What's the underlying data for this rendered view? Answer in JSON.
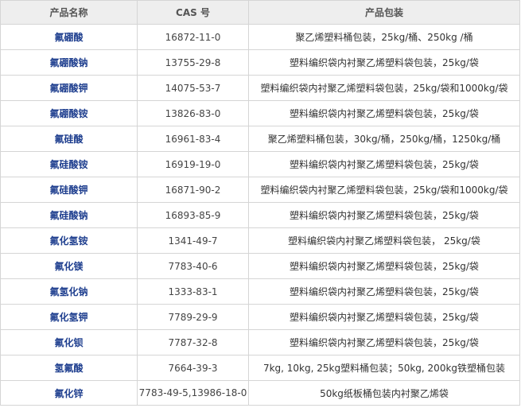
{
  "headers": {
    "name": "产品名称",
    "cas": "CAS 号",
    "packaging": "产品包装"
  },
  "colors": {
    "header_bg": "#eeeeee",
    "name_text": "#1f3f8f",
    "border": "#d5d5d5"
  },
  "rows": [
    {
      "name": "氟硼酸",
      "cas": "16872-11-0",
      "packaging": "聚乙烯塑料桶包装，25kg/桶、250kg /桶"
    },
    {
      "name": "氟硼酸钠",
      "cas": "13755-29-8",
      "packaging": "塑料编织袋内衬聚乙烯塑料袋包装，25kg/袋"
    },
    {
      "name": "氟硼酸钾",
      "cas": "14075-53-7",
      "packaging": "塑料编织袋内衬聚乙烯塑料袋包装，25kg/袋和1000kg/袋"
    },
    {
      "name": "氟硼酸铵",
      "cas": "13826-83-0",
      "packaging": "塑料编织袋内衬聚乙烯塑料袋包装，25kg/袋"
    },
    {
      "name": "氟硅酸",
      "cas": "16961-83-4",
      "packaging": "聚乙烯塑料桶包装，30kg/桶，250kg/桶，1250kg/桶"
    },
    {
      "name": "氟硅酸铵",
      "cas": "16919-19-0",
      "packaging": "塑料编织袋内衬聚乙烯塑料袋包装，25kg/袋"
    },
    {
      "name": "氟硅酸钾",
      "cas": "16871-90-2",
      "packaging": "塑料编织袋内衬聚乙烯塑料袋包装，25kg/袋和1000kg/袋"
    },
    {
      "name": "氟硅酸钠",
      "cas": "16893-85-9",
      "packaging": "塑料编织袋内衬聚乙烯塑料袋包装，25kg/袋"
    },
    {
      "name": "氟化氢铵",
      "cas": "1341-49-7",
      "packaging": "塑料编织袋内衬聚乙烯塑料袋包装， 25kg/袋"
    },
    {
      "name": "氟化镁",
      "cas": "7783-40-6",
      "packaging": "塑料编织袋内衬聚乙烯塑料袋包装，25kg/袋"
    },
    {
      "name": "氟氢化钠",
      "cas": "1333-83-1",
      "packaging": "塑料编织袋内衬聚乙烯塑料袋包装，25kg/袋"
    },
    {
      "name": "氟化氢钾",
      "cas": "7789-29-9",
      "packaging": "塑料编织袋内衬聚乙烯塑料袋包装，25kg/袋"
    },
    {
      "name": "氟化钡",
      "cas": "7787-32-8",
      "packaging": "塑料编织袋内衬聚乙烯塑料袋包装，25kg/袋"
    },
    {
      "name": "氢氟酸",
      "cas": "7664-39-3",
      "packaging": "7kg, 10kg, 25kg塑料桶包装；50kg, 200kg铁塑桶包装"
    },
    {
      "name": "氟化锌",
      "cas": "7783-49-5,13986-18-0",
      "packaging": "50kg纸板桶包装内衬聚乙烯袋"
    }
  ]
}
